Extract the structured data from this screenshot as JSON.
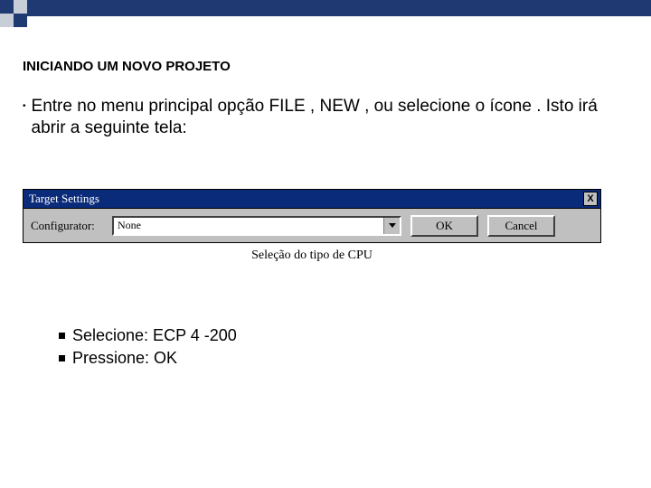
{
  "decor": {},
  "heading": "INICIANDO UM NOVO PROJETO",
  "intro": {
    "text": "Entre no menu principal opção FILE , NEW , ou selecione o ícone . Isto irá abrir a seguinte tela:"
  },
  "dialog": {
    "title": "Target Settings",
    "close": "X",
    "field_label": "Configurator:",
    "dropdown_value": "None",
    "ok_label": "OK",
    "cancel_label": "Cancel",
    "caption": "Seleção do tipo de CPU"
  },
  "sub": {
    "item1": "Selecione: ECP 4 -200",
    "item2": "Pressione: OK"
  }
}
